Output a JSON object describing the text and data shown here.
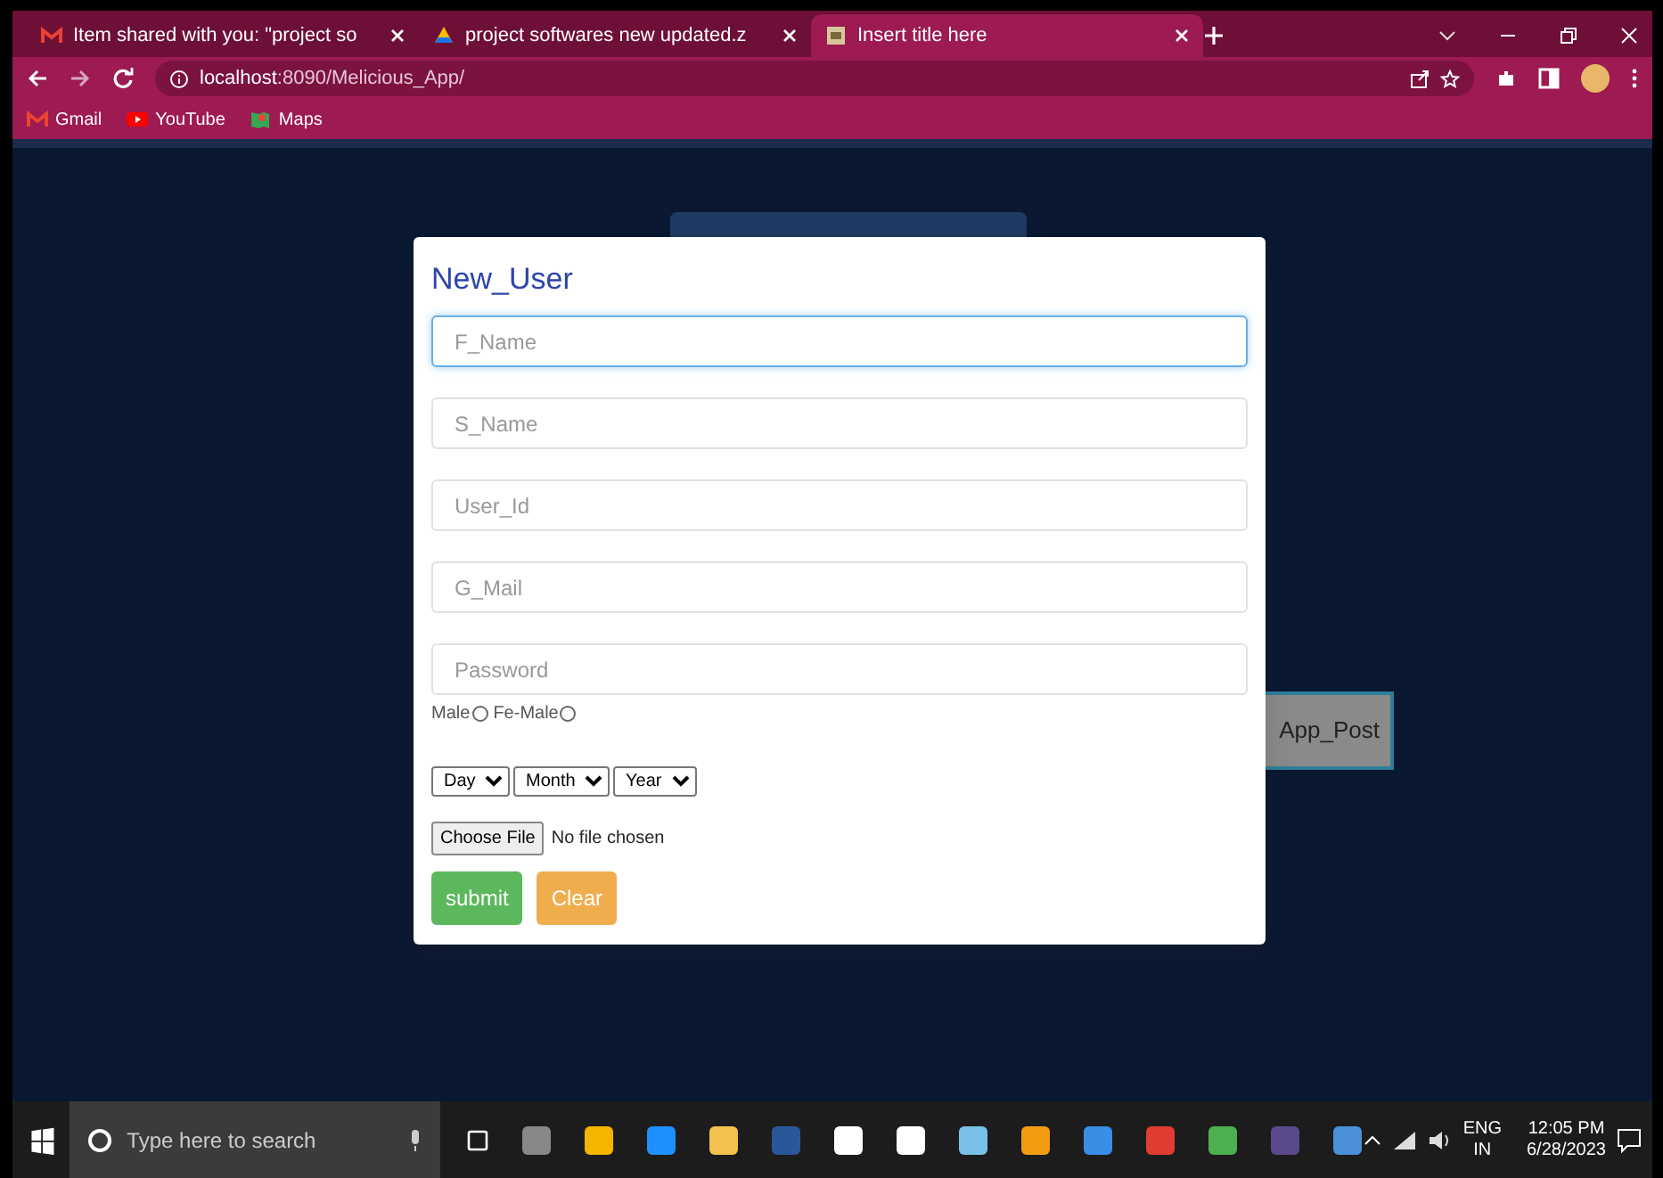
{
  "browser": {
    "tabs": [
      {
        "title": "Item shared with you: \"project so",
        "selected": false
      },
      {
        "title": "project softwares new updated.z",
        "selected": false
      },
      {
        "title": "Insert title here",
        "selected": true
      }
    ],
    "address": "**localhost**:8090/Melicious_App/",
    "bookmarks": [
      "Gmail",
      "YouTube",
      "Maps"
    ]
  },
  "page": {
    "background_button": "App_Post",
    "modal": {
      "title": "New_User",
      "fields": [
        {
          "placeholder": "F_Name",
          "focused": true
        },
        {
          "placeholder": "S_Name",
          "focused": false
        },
        {
          "placeholder": "User_Id",
          "focused": false
        },
        {
          "placeholder": "G_Mail",
          "focused": false
        },
        {
          "placeholder": "Password",
          "focused": false
        }
      ],
      "genders": [
        {
          "label": "Male",
          "checked": false
        },
        {
          "label": "Fe-Male",
          "checked": false
        }
      ],
      "selects": [
        "Day",
        "Month",
        "Year"
      ],
      "file": {
        "button": "Choose File",
        "status": "No file chosen"
      },
      "buttons": [
        {
          "label": "submit",
          "kind": "success"
        },
        {
          "label": "Clear",
          "kind": "warning"
        }
      ]
    }
  },
  "taskbar": {
    "search_placeholder": "Type here to search",
    "language": "ENG",
    "region": "IN",
    "time": "12:05 PM",
    "date": "6/28/2023"
  }
}
